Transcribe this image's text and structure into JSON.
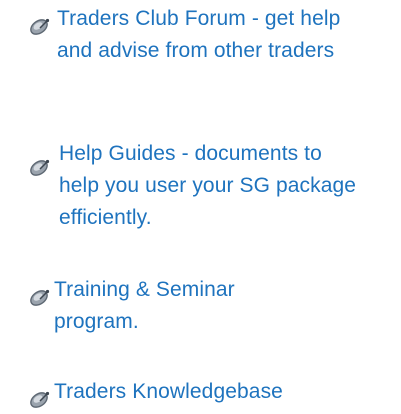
{
  "links": [
    {
      "label": "Traders Club Forum - get help and advise from other traders",
      "icon": "satellite-dish-icon"
    },
    {
      "label": "Help Guides - documents to help you user your SG package efficiently.",
      "icon": "satellite-dish-icon"
    },
    {
      "label": "Training & Seminar program.",
      "icon": "satellite-dish-icon"
    },
    {
      "label": "Traders Knowledgebase",
      "icon": "satellite-dish-icon"
    }
  ],
  "colors": {
    "link": "#1e73be",
    "icon_disc": "#9aa3ad",
    "icon_rim": "#5e6873",
    "icon_feed": "#3d4650"
  }
}
